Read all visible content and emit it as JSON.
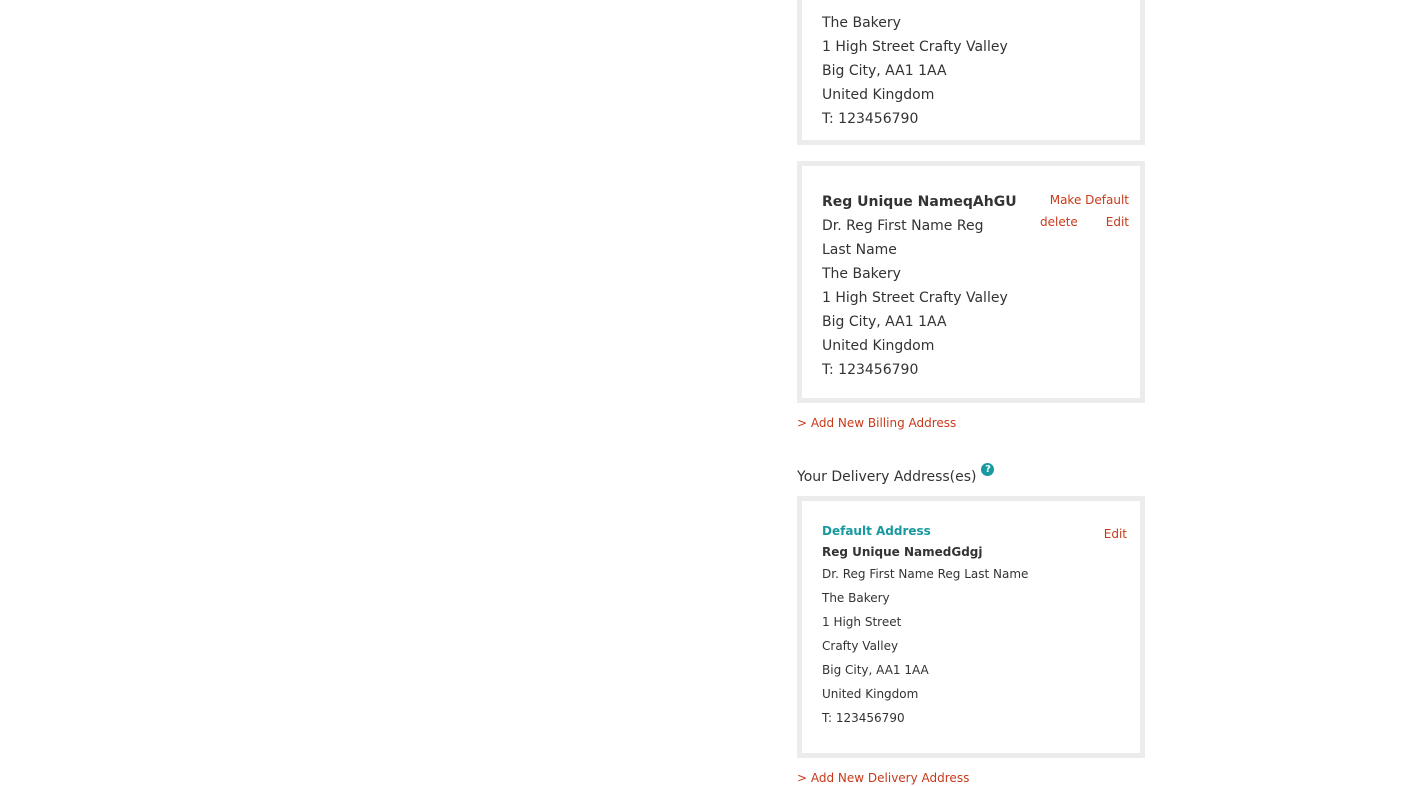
{
  "billing_card_1": {
    "company": "The Bakery",
    "street": "1 High Street Crafty Valley",
    "city_postcode": "Big City, AA1 1AA",
    "country": "United Kingdom",
    "phone": "T: 123456790"
  },
  "billing_card_2": {
    "nickname": "Reg Unique NameqAhGU",
    "full_name": "Dr. Reg First Name Reg Last Name",
    "company": "The Bakery",
    "street": "1 High Street Crafty Valley",
    "city_postcode": "Big City, AA1 1AA",
    "country": "United Kingdom",
    "phone": "T: 123456790",
    "make_default_label": "Make Default",
    "delete_label": "delete",
    "edit_label": "Edit"
  },
  "add_billing_label": "> Add New Billing Address",
  "delivery_section": {
    "title": "Your Delivery Address(es)",
    "help_glyph": "?"
  },
  "delivery_card": {
    "default_label": "Default Address",
    "nickname": "Reg Unique NamedGdgj",
    "full_name": "Dr. Reg First Name Reg Last Name",
    "company": "The Bakery",
    "street": "1 High Street",
    "locality": "Crafty Valley",
    "city_postcode": "Big City, AA1 1AA",
    "country": "United Kingdom",
    "phone": "T: 123456790",
    "edit_label": "Edit"
  },
  "add_delivery_label": "> Add New Delivery Address",
  "colors": {
    "link": "#c8391a",
    "accent": "#17999f",
    "card_border": "#ececec",
    "text": "#333333"
  }
}
